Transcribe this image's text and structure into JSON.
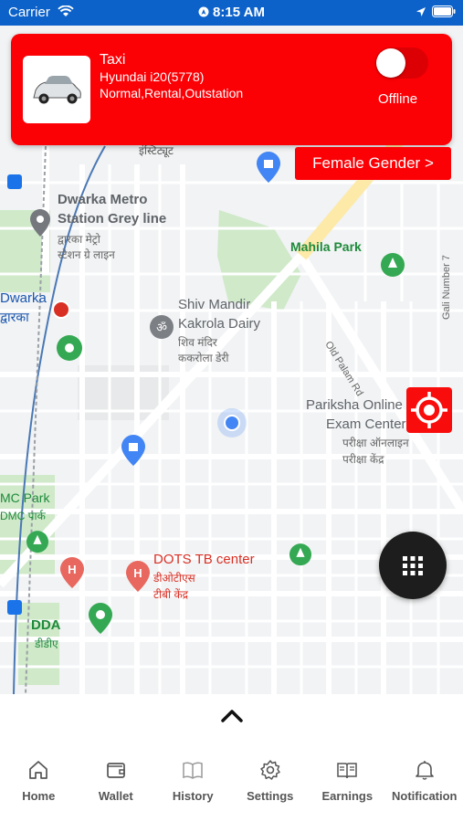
{
  "status_bar": {
    "carrier": "Carrier",
    "time": "8:15 AM"
  },
  "driver_card": {
    "vehicle_type": "Taxi",
    "vehicle_model": "Hyundai i20(5778)",
    "services": "Normal,Rental,Outstation",
    "online_status": "Offline",
    "toggle_on": false
  },
  "gender_button": {
    "label": "Female Gender >"
  },
  "map": {
    "labels": {
      "dwarka_metro_1": "Dwarka Metro",
      "dwarka_metro_2": "Station Grey line",
      "dwarka_metro_hi1": "द्वारका मेट्रो",
      "dwarka_metro_hi2": "स्टेशन ग्रे लाइन",
      "mahila_park": "Mahila Park",
      "dwarka": "Dwarka",
      "dwarka_hi": "द्वारका",
      "shiv_mandir_1": "Shiv Mandir",
      "shiv_mandir_2": "Kakrola Dairy",
      "shiv_mandir_hi1": "शिव मंदिर",
      "shiv_mandir_hi2": "ककरोला डेरी",
      "pariksha_1": "Pariksha Online",
      "pariksha_2": "Exam Center",
      "pariksha_hi1": "परीक्षा ऑनलाइन",
      "pariksha_hi2": "परीक्षा केंद्र",
      "dmc_park": "MC Park",
      "dmc_park_hi": "DMC पार्क",
      "dots_tb": "DOTS TB center",
      "dots_tb_hi1": "डीओटीएस",
      "dots_tb_hi2": "टीबी केंद्र",
      "dda": "DDA",
      "dda_hi": "डीडीए",
      "old_palam": "Old Palam Rd",
      "gali_number": "Gali Number 7",
      "institute": "इंस्टिट्यूट"
    }
  },
  "nav": {
    "items": [
      {
        "label": "Home",
        "icon": "home-icon"
      },
      {
        "label": "Wallet",
        "icon": "wallet-icon"
      },
      {
        "label": "History",
        "icon": "book-icon"
      },
      {
        "label": "Settings",
        "icon": "gear-icon"
      },
      {
        "label": "Earnings",
        "icon": "ledger-icon"
      },
      {
        "label": "Notification",
        "icon": "bell-icon"
      }
    ]
  },
  "colors": {
    "status_bar": "#0d62c9",
    "card": "#fb0005",
    "map_bg": "#f1f3f4",
    "park": "#cfe9c9"
  }
}
